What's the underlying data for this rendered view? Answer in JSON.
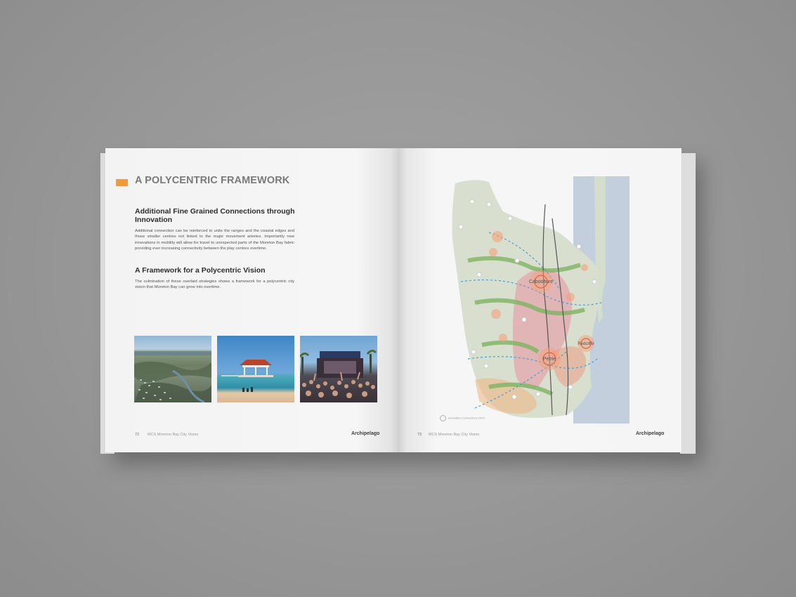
{
  "left_page": {
    "title": "A POLYCENTRIC FRAMEWORK",
    "section1_heading": "Additional Fine Grained Connections through Innovation",
    "section1_body": "Additional connection can be reinforced to unite the ranges and the coastal edges and those smaller centres not linked to the major movement arteries. Importantly new innovations in mobility will allow for travel to unexpected parts of the Moreton Bay fabric providing ever increasing connectivity between the play centres overtime.",
    "section2_heading": "A Framework for a Polycentric Vision",
    "section2_body": "The culmination of these overlaid strategies shows a framework for a polycentric city vision that Moreton Bay can grow into overtime.",
    "page_number": "72",
    "footer_text": "MCS Moreton Bay City Vision",
    "logo": "Archipelago"
  },
  "right_page": {
    "map_labels": {
      "centre_north": "Caboolture",
      "centre_south": "Petrie",
      "centre_east": "Redcliffe"
    },
    "legend_text": "Innovative Connections 2070",
    "page_number": "73",
    "footer_text": "MCS Moreton Bay City Vision",
    "logo": "Archipelago"
  },
  "colors": {
    "background": "#9a9a9a",
    "accent": "#f09a3a",
    "map_land": "#d9dfcf",
    "map_water": "#c3cfdc",
    "map_corridor": "#7fb463",
    "map_urban": "#e88fa3",
    "map_centre": "#f4a278"
  }
}
